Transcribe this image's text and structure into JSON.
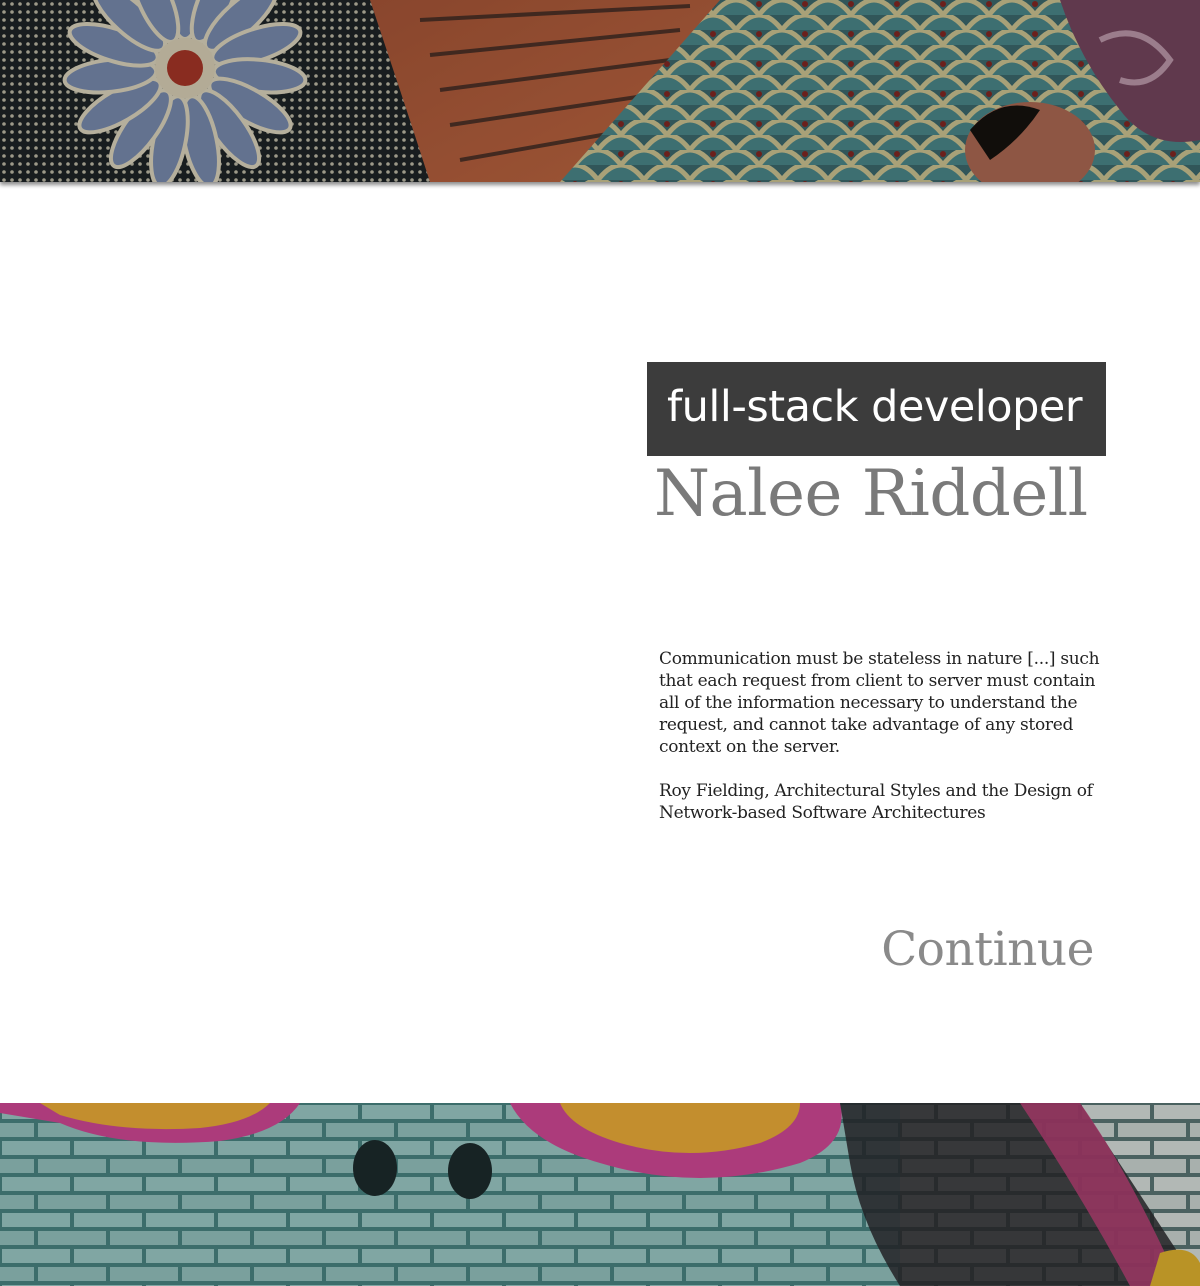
{
  "header": {
    "role": "full-stack developer",
    "name": "Nalee Riddell"
  },
  "quote": {
    "text": "Communication must be stateless in nature [...] such that each request from client to server must contain all of the information necessary to understand the request, and cannot take advantage of any stored context on the server.",
    "attribution": "Roy Fielding, Architectural Styles and the Design of Network-based Software Architectures"
  },
  "actions": {
    "continue_label": "Continue"
  },
  "images": {
    "top_banner": "decorative-ceramic-tile-mural",
    "bottom_banner": "graffiti-brick-wall-mural"
  },
  "colors": {
    "badge_background": "#3c3c3c",
    "name_text": "#7a7a7a",
    "body_text": "#222222",
    "continue_text": "#8a8a8a",
    "page_background": "#ffffff"
  }
}
